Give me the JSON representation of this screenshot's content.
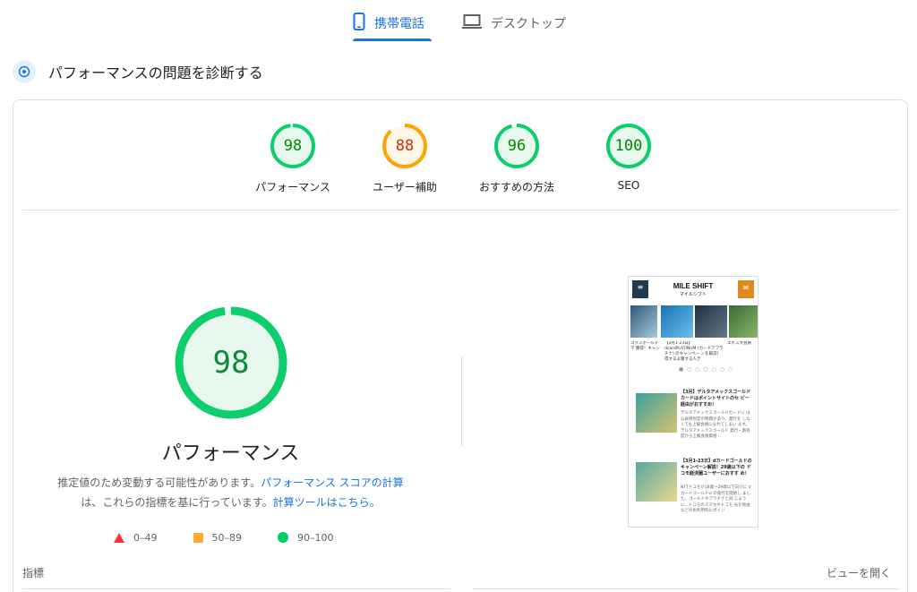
{
  "tabs": {
    "mobile": {
      "label": "携帯電話",
      "icon": "phone-icon",
      "active": true
    },
    "desktop": {
      "label": "デスクトップ",
      "icon": "laptop-icon",
      "active": false
    }
  },
  "section": {
    "title": "パフォーマンスの問題を診断する",
    "icon": "diagnose-icon"
  },
  "scores": [
    {
      "value": "98",
      "label": "パフォーマンス",
      "status": "pass",
      "fraction": 0.98
    },
    {
      "value": "88",
      "label": "ユーザー補助",
      "status": "average",
      "fraction": 0.88
    },
    {
      "value": "96",
      "label": "おすすめの方法",
      "status": "pass",
      "fraction": 0.96
    },
    {
      "value": "100",
      "label": "SEO",
      "status": "pass",
      "fraction": 1.0
    }
  ],
  "main": {
    "score": "98",
    "fraction": 0.98,
    "label": "パフォーマンス",
    "desc_prefix": "推定値のため変動する可能性があります。",
    "desc_link1": "パフォーマンス スコアの計算",
    "desc_middle": "は、これらの指標を基に行っています。",
    "desc_link2": "計算ツールはこちら。"
  },
  "legend": [
    {
      "range": "0–49",
      "shape": "triangle",
      "color": "#f33"
    },
    {
      "range": "50–89",
      "shape": "square",
      "color": "#fa3"
    },
    {
      "range": "90–100",
      "shape": "circle",
      "color": "#0c6"
    }
  ],
  "metrics": {
    "label": "指標",
    "view_toggle": "ビューを開く"
  },
  "colors": {
    "pass": "#0cce6b",
    "pass_text": "#008800",
    "pass_bg": "#e8f8ee",
    "average": "#ffa400",
    "average_text": "#c33300",
    "average_bg": "#fff6e8",
    "accent": "#1a73e8"
  },
  "screenshot": {
    "logo": "MILE SHIFT",
    "logo_sub": "マイルシフト",
    "captions": [
      "ゴクスボールドマ 獲得！キャン",
      "【3月1-23日】dcardPLATINUM (カードアプラチナ) のキャンペー ンを解説！得するよ獲する人ぎ",
      "エポス大会員"
    ],
    "articles": [
      {
        "title": "【3月】デルタアメックスゴールドカードはポイントサイトのセ ビー経由がおすすめ！",
        "text": "デルタアメックスゴールドカードに は公表特別定の特典があり、発行を しなくても上級会員になれてしまい ます。デルタアメックスゴールド 発行・割有度から上級会員資格 ..."
      },
      {
        "title": "【3月1-23日】dカードゴールドの キャンペーン解説！29歳以下の ドコモ経済圏ユーザーにおすす め！",
        "text": "NTTドコモが18歳〜29歳以下向けに dカードゴールドU の発行を開始し ました。ゴールドやプラチナと同 じように、ドコモのスマホやドコモ 光を経由などのお利用料にポイン"
      }
    ]
  }
}
